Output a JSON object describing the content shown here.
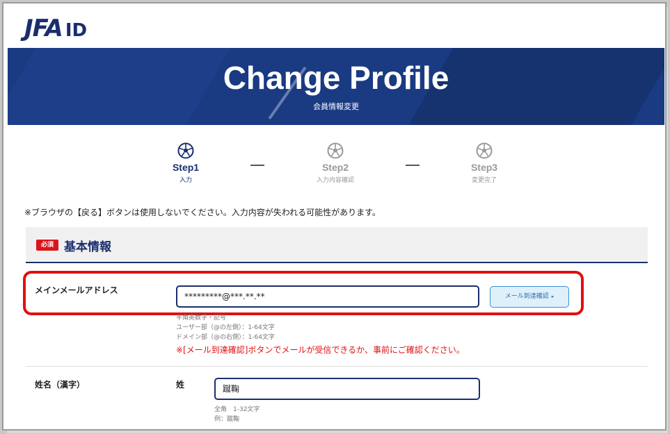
{
  "header": {
    "logo_main": "JFA",
    "logo_suffix": "ID"
  },
  "hero": {
    "title": "Change Profile",
    "subtitle": "会員情報変更"
  },
  "steps": [
    {
      "name": "Step1",
      "desc": "入力",
      "active": true
    },
    {
      "name": "Step2",
      "desc": "入力内容確認",
      "active": false
    },
    {
      "name": "Step3",
      "desc": "変更完了",
      "active": false
    }
  ],
  "notice": "※ブラウザの【戻る】ボタンは使用しないでください。入力内容が失われる可能性があります。",
  "section": {
    "badge": "必須",
    "title": "基本情報"
  },
  "email": {
    "label": "メインメールアドレス",
    "value": "*********@***.**.**",
    "verify_button": "メール到達確認",
    "hints": [
      "半角英数字・記号",
      "ユーザー部（@の左側）：1-64文字",
      "ドメイン部（@の右側）：1-64文字"
    ],
    "warning": "※[メール到達確認]ボタンでメールが受信できるか、事前にご確認ください。"
  },
  "name_kanji": {
    "label": "姓名（漢字）",
    "sub_label": "姓",
    "value": "蹴鞠",
    "hints": [
      "全角　1-32文字",
      "例：蹴鞠"
    ]
  },
  "colors": {
    "brand_navy": "#1a2e6e",
    "hero_blue": "#1a3a82",
    "alert_red": "#e01010",
    "button_bg": "#dff0fa"
  }
}
